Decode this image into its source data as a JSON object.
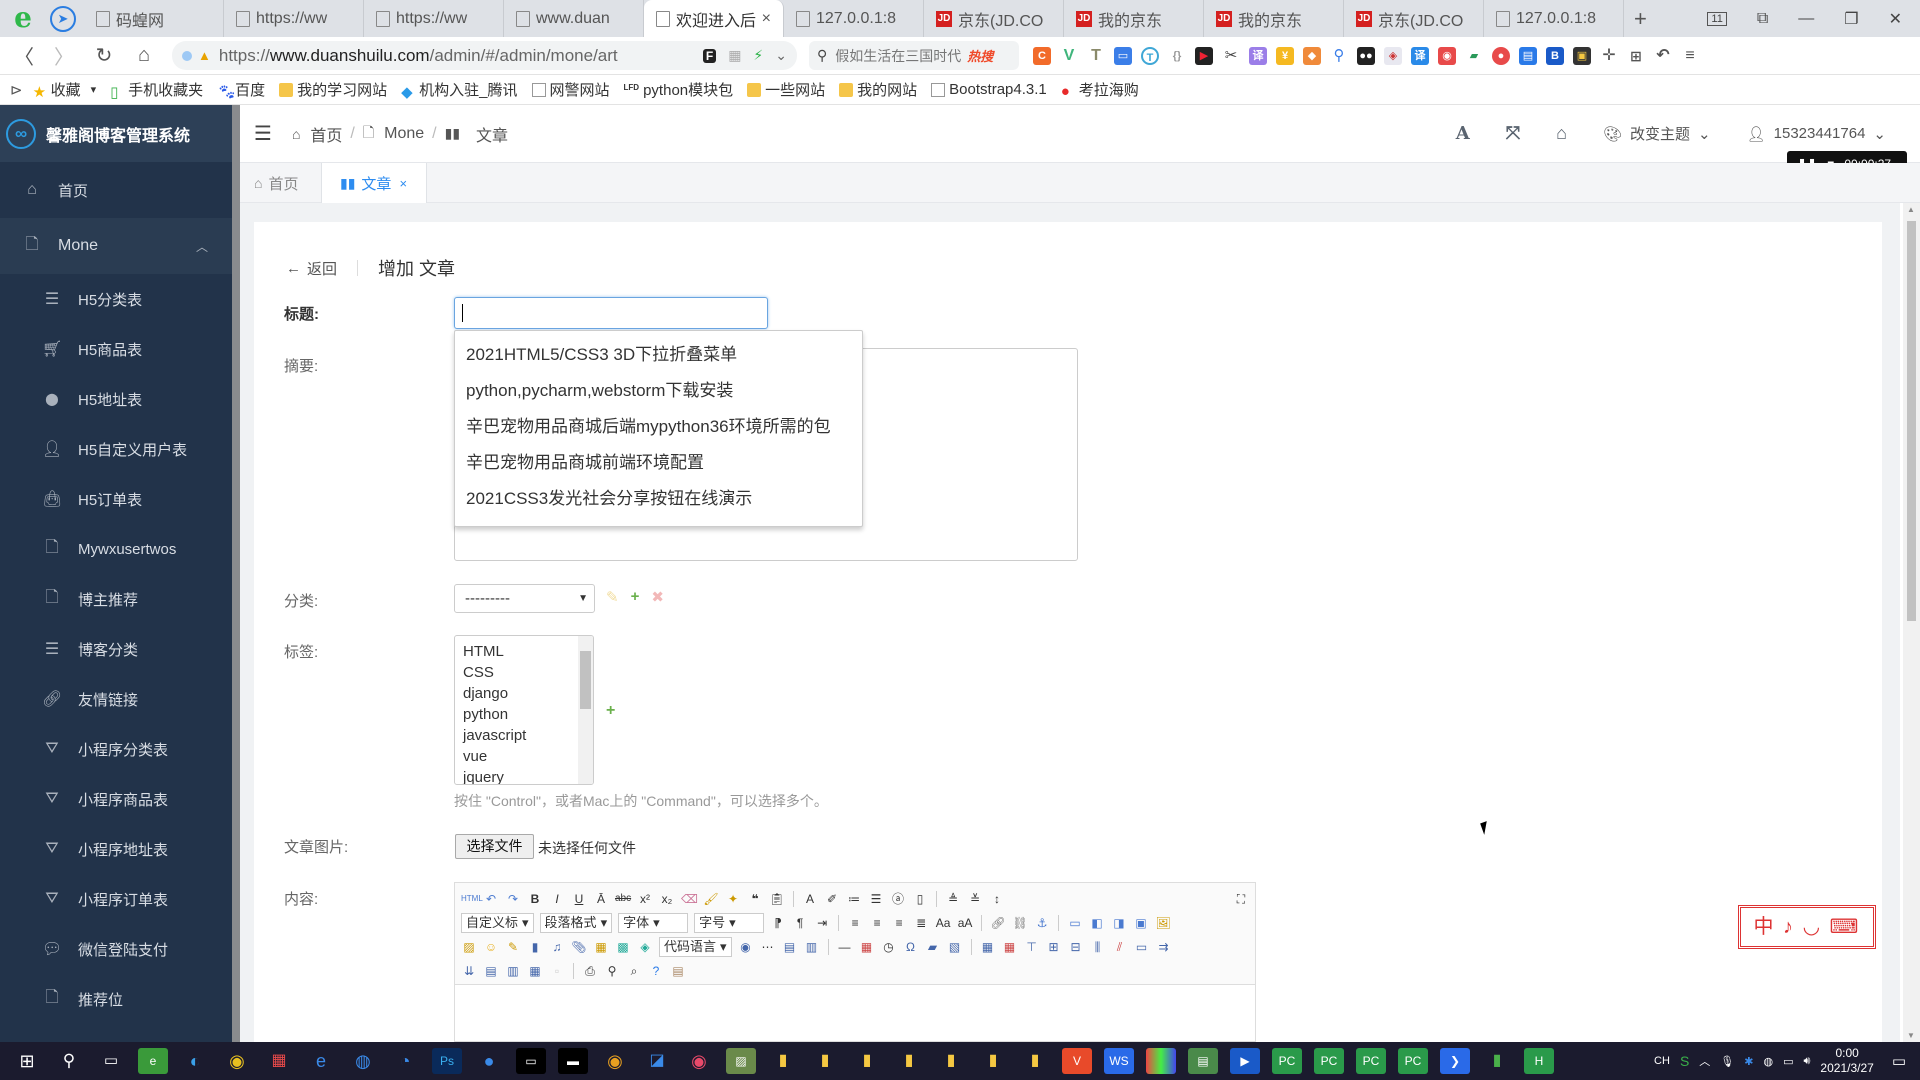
{
  "browser": {
    "tabs": [
      {
        "label": "码蝗网",
        "icon": "doc"
      },
      {
        "label": "https://ww",
        "icon": "doc"
      },
      {
        "label": "https://ww",
        "icon": "doc"
      },
      {
        "label": "www.duan",
        "icon": "doc"
      },
      {
        "label": "欢迎进入后",
        "icon": "doc",
        "active": true,
        "close": "×"
      },
      {
        "label": "127.0.0.1:8",
        "icon": "doc"
      },
      {
        "label": "京东(JD.CO",
        "icon": "jd"
      },
      {
        "label": "我的京东",
        "icon": "jd"
      },
      {
        "label": "我的京东",
        "icon": "jd"
      },
      {
        "label": "京东(JD.CO",
        "icon": "jd"
      },
      {
        "label": "127.0.0.1:8",
        "icon": "doc"
      }
    ],
    "new_tab": "+",
    "tab_count": "11",
    "url_scheme": "https://",
    "url_host": "www.duanshuilu.com",
    "url_path": "/admin/#/admin/mone/art",
    "search_placeholder": "假如生活在三国时代",
    "search_hot": "热搜",
    "bookmarks": [
      {
        "label": "收藏",
        "icon": "star"
      },
      {
        "label": "手机收藏夹",
        "icon": "phone"
      },
      {
        "label": "百度",
        "icon": "baidu"
      },
      {
        "label": "我的学习网站",
        "icon": "folder"
      },
      {
        "label": "机构入驻_腾讯",
        "icon": "tencent"
      },
      {
        "label": "网警网站",
        "icon": "doc"
      },
      {
        "label": "python模块包",
        "icon": "lfd"
      },
      {
        "label": "一些网站",
        "icon": "folder"
      },
      {
        "label": "我的网站",
        "icon": "folder"
      },
      {
        "label": "Bootstrap4.3.1",
        "icon": "doc"
      },
      {
        "label": "考拉海购",
        "icon": "kaola"
      }
    ]
  },
  "app": {
    "brand": "馨雅阁博客管理系统",
    "brand_logo": "∞",
    "sidebar": {
      "home": "首页",
      "group": "Mone",
      "items": [
        {
          "label": "H5分类表",
          "icon": "list-icon"
        },
        {
          "label": "H5商品表",
          "icon": "cart-icon"
        },
        {
          "label": "H5地址表",
          "icon": "map-marker-icon"
        },
        {
          "label": "H5自定义用户表",
          "icon": "user-icon"
        },
        {
          "label": "H5订单表",
          "icon": "shopping-bag-icon"
        },
        {
          "label": "Mywxusertwos",
          "icon": "file-icon"
        },
        {
          "label": "博主推荐",
          "icon": "file-icon"
        },
        {
          "label": "博客分类",
          "icon": "list-icon"
        },
        {
          "label": "友情链接",
          "icon": "link-icon"
        },
        {
          "label": "小程序分类表",
          "icon": "app-store-icon"
        },
        {
          "label": "小程序商品表",
          "icon": "app-store-icon"
        },
        {
          "label": "小程序地址表",
          "icon": "app-store-icon"
        },
        {
          "label": "小程序订单表",
          "icon": "app-store-icon"
        },
        {
          "label": "微信登陆支付",
          "icon": "wechat-icon"
        },
        {
          "label": "推荐位",
          "icon": "file-icon"
        }
      ]
    },
    "breadcrumb": [
      "首页",
      "Mone",
      "文章"
    ],
    "header": {
      "theme_label": "改变主题",
      "user": "15323441764"
    },
    "recorder_time": "00:00:27",
    "page_tabs": [
      {
        "label": "首页"
      },
      {
        "label": "文章",
        "active": true,
        "close": "×"
      }
    ],
    "form": {
      "back_label": "返回",
      "title": "增加 文章",
      "title_label": "标题:",
      "title_value": "",
      "summary_label": "摘要:",
      "category_label": "分类:",
      "category_value": "---------",
      "tags_label": "标签:",
      "tags": [
        "HTML",
        "CSS",
        "django",
        "python",
        "javascript",
        "vue",
        "jquery"
      ],
      "tags_help": "按住 \"Control\"，或者Mac上的 \"Command\"，可以选择多个。",
      "image_label": "文章图片:",
      "file_button": "选择文件",
      "file_status": "未选择任何文件",
      "content_label": "内容:",
      "autocomplete": [
        "2021HTML5/CSS3 3D下拉折叠菜单",
        "python,pycharm,webstorm下载安装",
        "辛巴宠物用品商城后端mypython36环境所需的包",
        "辛巴宠物用品商城前端环境配置",
        "2021CSS3发光社会分享按钮在线演示"
      ],
      "editor_selects": [
        "自定义标",
        "段落格式",
        "字体",
        "字号",
        "代码语言"
      ]
    }
  },
  "ime_badge": "中 ♪ ◡ ⌨",
  "taskbar": {
    "time": "0:00",
    "date": "2021/3/27",
    "ime": "CH"
  }
}
